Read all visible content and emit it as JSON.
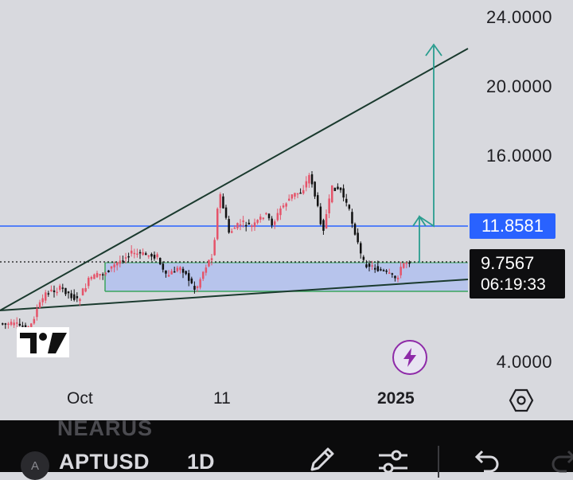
{
  "price_axis": {
    "labels": [
      "24.0000",
      "20.0000",
      "16.0000",
      "4.0000"
    ]
  },
  "time_axis": {
    "labels": [
      {
        "text": "Oct",
        "bold": false
      },
      {
        "text": "11",
        "bold": false
      },
      {
        "text": "2025",
        "bold": true
      }
    ]
  },
  "horizontal_line": {
    "price": "11.8581",
    "color": "#2962ff"
  },
  "current_price": {
    "price": "9.7567",
    "countdown": "06:19:33"
  },
  "colors": {
    "up_candle": "#e5546a",
    "down_candle": "#111111",
    "trendline": "#1a3a2e",
    "target_arrow": "#2a9d8f",
    "zone_fill": "#b7c4ec",
    "zone_border": "#3ba55c",
    "background": "#d8d9de"
  },
  "icons": {
    "logo": "tradingview-logo-icon",
    "flash": "flash-icon",
    "settings": "hexagon-settings-icon",
    "pencil": "pencil-icon",
    "indicators": "sliders-icon",
    "undo": "undo-icon",
    "redo": "redo-icon"
  },
  "toolbar": {
    "ghost_symbol": "NEARUS",
    "avatar_letter": "A",
    "symbol": "APTUSD",
    "interval": "1D"
  }
}
